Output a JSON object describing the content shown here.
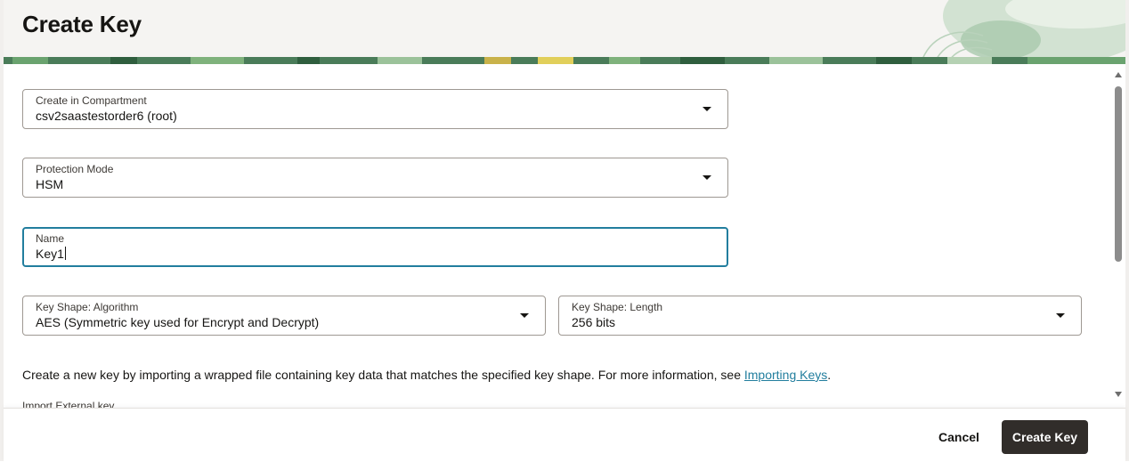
{
  "header": {
    "title": "Create Key"
  },
  "form": {
    "compartment": {
      "label": "Create in Compartment",
      "value": "csv2saastestorder6 (root)"
    },
    "protection_mode": {
      "label": "Protection Mode",
      "value": "HSM"
    },
    "name": {
      "label": "Name",
      "value": "Key1"
    },
    "key_shape_algorithm": {
      "label": "Key Shape: Algorithm",
      "value": "AES (Symmetric key used for Encrypt and Decrypt)"
    },
    "key_shape_length": {
      "label": "Key Shape: Length",
      "value": "256 bits"
    },
    "import_info": {
      "text": "Create a new key by importing a wrapped file containing key data that matches the specified key shape. For more information, see ",
      "link": "Importing Keys",
      "suffix": "."
    },
    "import_external_key_label": "Import External key"
  },
  "footer": {
    "cancel_label": "Cancel",
    "create_label": "Create Key"
  },
  "colors": {
    "accent": "#227e9e",
    "primary_button": "#312d2a",
    "header_bg": "#f5f4f2"
  }
}
